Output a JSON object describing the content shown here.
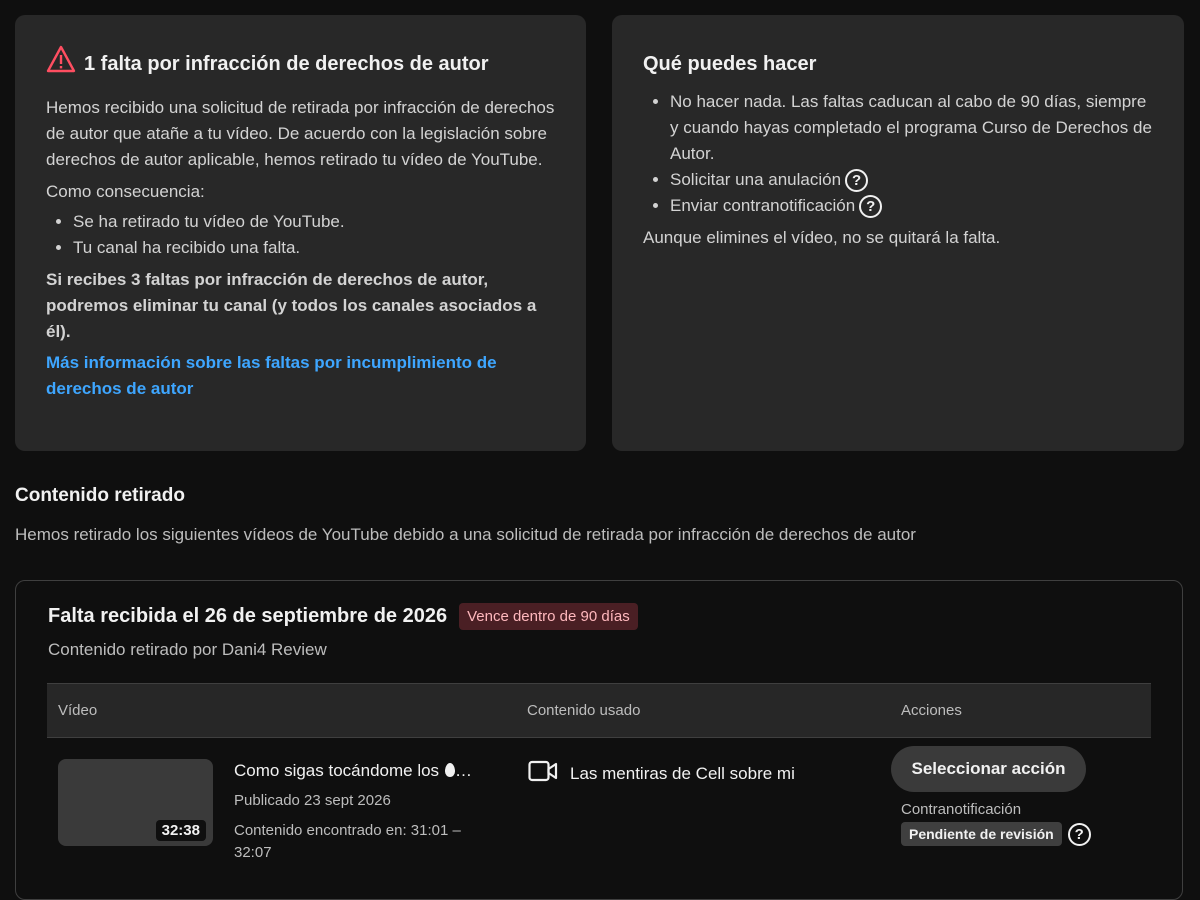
{
  "strike_card": {
    "title": "1 falta por infracción de derechos de autor",
    "paragraph": "Hemos recibido una solicitud de retirada por infracción de derechos de autor que atañe a tu vídeo. De acuerdo con la legislación sobre derechos de autor aplicable, hemos retirado tu vídeo de YouTube.",
    "consequence_label": "Como consecuencia:",
    "consequences": [
      "Se ha retirado tu vídeo de YouTube.",
      "Tu canal ha recibido una falta."
    ],
    "warning": "Si recibes 3 faltas por infracción de derechos de autor, podremos eliminar tu canal (y todos los canales asociados a él).",
    "link": "Más información sobre las faltas por incumplimiento de derechos de autor"
  },
  "options_card": {
    "title": "Qué puedes hacer",
    "options": [
      "No hacer nada. Las faltas caducan al cabo de 90 días, siempre y cuando hayas completado el programa Curso de Derechos de Autor.",
      "Solicitar una anulación",
      "Enviar contranotificación"
    ],
    "note": "Aunque elimines el vídeo, no se quitará la falta."
  },
  "removed_section": {
    "title": "Contenido retirado",
    "description": "Hemos retirado los siguientes vídeos de YouTube debido a una solicitud de retirada por infracción de derechos de autor"
  },
  "strike_panel": {
    "date_title": "Falta recibida el 26 de septiembre de 2026",
    "expiry_badge": "Vence dentro de 90 días",
    "removed_by": "Contenido retirado por Dani4 Review",
    "table": {
      "headers": [
        "Vídeo",
        "Contenido usado",
        "Acciones"
      ],
      "row": {
        "duration": "32:38",
        "title": "Como sigas tocándome los",
        "title_ellipsis": "…",
        "published": "Publicado 23 sept 2026",
        "found": "Contenido encontrado en: 31:01 – 32:07",
        "content_used": "Las mentiras de Cell sobre mi",
        "action_button": "Seleccionar acción",
        "counter_label": "Contranotificación",
        "status": "Pendiente de revisión"
      }
    }
  },
  "icons": {
    "warning": "warning-triangle-icon",
    "help": "help-circle-icon",
    "video": "video-camera-icon",
    "egg": "egg-emoji-icon",
    "help_glyph": "?"
  },
  "colors": {
    "link": "#3ea6ff",
    "warning": "#ff4e61",
    "badge_bg": "#4a1f24"
  }
}
